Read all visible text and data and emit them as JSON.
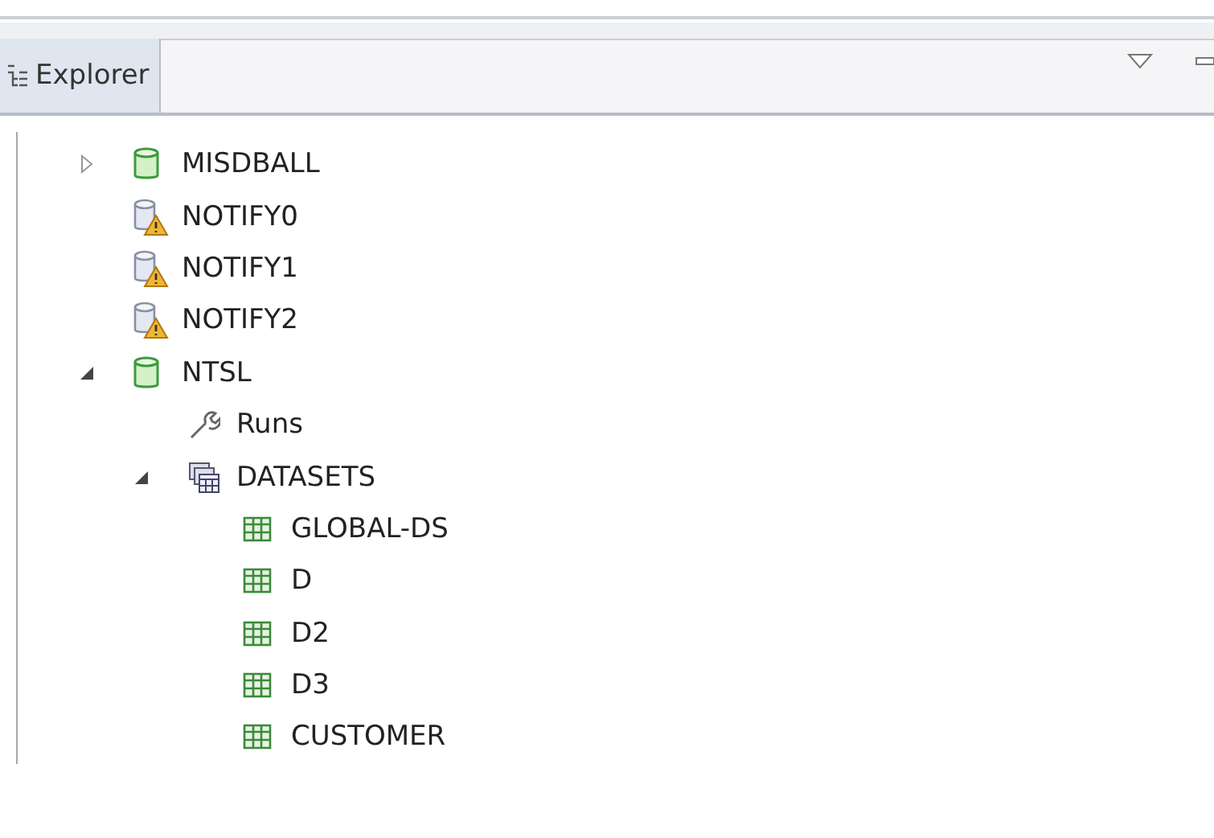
{
  "view": {
    "tab": {
      "label": "Explorer",
      "selected": true
    }
  },
  "tree": [
    {
      "label": "MISDBALL",
      "kind": "database",
      "expanded": false
    },
    {
      "label": "NOTIFY0",
      "kind": "database-warning"
    },
    {
      "label": "NOTIFY1",
      "kind": "database-warning"
    },
    {
      "label": "NOTIFY2",
      "kind": "database-warning"
    },
    {
      "label": "NTSL",
      "kind": "database",
      "expanded": true,
      "children": [
        {
          "label": "Runs",
          "kind": "runs"
        },
        {
          "label": "DATASETS",
          "kind": "datasets",
          "expanded": true,
          "children": [
            {
              "label": "GLOBAL-DS",
              "kind": "table"
            },
            {
              "label": "D",
              "kind": "table"
            },
            {
              "label": "D2",
              "kind": "table"
            },
            {
              "label": "D3",
              "kind": "table"
            },
            {
              "label": "CUSTOMER",
              "kind": "table"
            }
          ]
        }
      ]
    }
  ]
}
